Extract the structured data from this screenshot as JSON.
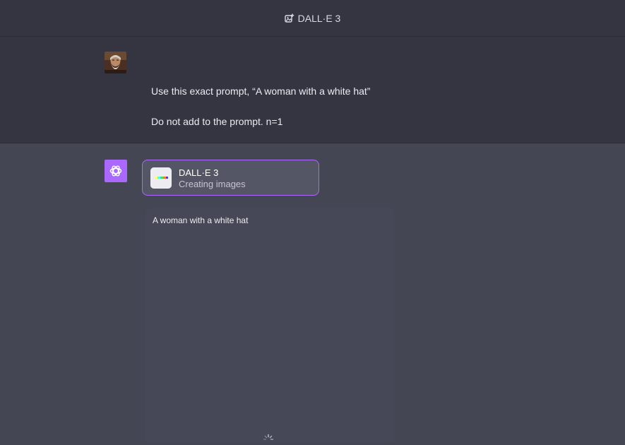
{
  "header": {
    "title": "DALL·E 3",
    "icon": "image-plus-icon"
  },
  "user_message": {
    "avatar": "user-portrait-avatar",
    "line1": "Use this exact prompt, “A woman with a white hat”",
    "line2": "Do not add to the prompt. n=1"
  },
  "assistant": {
    "avatar_icon": "openai-logo-icon",
    "tool": {
      "name": "DALL·E 3",
      "status": "Creating images"
    },
    "image_prompt": "A woman with a white hat",
    "loading_icon": "spinner-icon"
  },
  "colors": {
    "accent": "#ab68ff",
    "header_bg": "#343541",
    "assistant_bg": "#444654"
  }
}
